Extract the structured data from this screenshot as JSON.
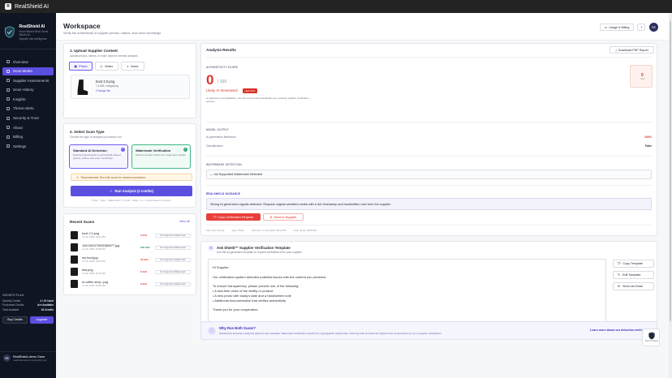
{
  "window": {
    "title": "RealShield AI"
  },
  "brand": {
    "name": "RealShield AI",
    "tagline": "Know What's Real. Know What's AI.",
    "subtag": "Supplier risk intelligence"
  },
  "nav": [
    {
      "label": "Overview"
    },
    {
      "label": "Scan Media",
      "active": true
    },
    {
      "label": "Supplier Assessments"
    },
    {
      "label": "Scan History"
    },
    {
      "label": "Insights"
    },
    {
      "label": "Threat Alerts"
    },
    {
      "label": "Security & Trust"
    },
    {
      "label": "About"
    },
    {
      "label": "Billing"
    },
    {
      "label": "Settings"
    }
  ],
  "growth": {
    "title": "GROWTH PLAN",
    "rows": [
      [
        "Monthly Credits",
        "4 / 10 Used"
      ],
      [
        "Purchased Credits",
        "Are Available"
      ],
      [
        "Total Available",
        "16 Credits"
      ]
    ],
    "buy": "Buy Credits",
    "upgrade": "Upgrade"
  },
  "user": {
    "initials": "RE",
    "name": "RealShield-demo Store",
    "email": "realshield-demo.myshopify.com"
  },
  "header": {
    "title": "Workspace",
    "subtitle": "Verify the authenticity of supplier photos, videos, and voice recordings",
    "usage": "Usage & Billing",
    "avatar": "RE"
  },
  "upload": {
    "title": "1. Upload Supplier Content",
    "sub": "Upload photos, videos, or voice clips for forensic analysis",
    "tabs": [
      "Photo",
      "Video",
      "Voice"
    ],
    "file": {
      "name": "boot 2.0.png",
      "meta": "1.5 MB  •  image/png",
      "change": "Change file"
    }
  },
  "scantype": {
    "title": "2. Select Scan Type",
    "sub": "Choose the type of analysis you want to run",
    "opt1": {
      "t": "Standard AI Detection",
      "d": "Detects AI-generated or synthetically altered photos, videos, and voice recordings"
    },
    "opt2": {
      "t": "Watermark Verification",
      "d": "Detects AI watermarks from supported models"
    },
    "reco": "Recommended: Run both scans for maximum protection",
    "run": "Run Analysis (2 credits)",
    "foot": "Photo · Video · Watermark = 1 credit · Video = 2 + 1 credit based on content"
  },
  "recent": {
    "title": "Recent Scans",
    "viewall": "View all",
    "items": [
      {
        "name": "boot 2.0.png",
        "date": "Jul 19, 2026, 04:01 PM",
        "pct": "0 Ai%",
        "color": "#d93025",
        "tag": "No Supported Watermark"
      },
      {
        "name": "1541352073535380577.jpg",
        "date": "Jul 19, 2026, 03:58 PM",
        "pct": "100 Ai%",
        "color": "#188038",
        "tag": "No Supported Watermark"
      },
      {
        "name": "my boot.jpg",
        "date": "Jul 19, 2026, 03:22 PM",
        "pct": "16 Ai%",
        "color": "#d93025",
        "tag": "No Supported Watermark"
      },
      {
        "name": "test.png",
        "date": "Jul 19, 2026, 03:15 PM",
        "pct": "6 Ai%",
        "color": "#d93025",
        "tag": "No Supported Watermark"
      },
      {
        "name": "ai coffee shop .png",
        "date": "Jul 19, 2026, 02:50 PM",
        "pct": "0 Ai%",
        "color": "#d93025",
        "tag": "No Supported Watermark"
      }
    ]
  },
  "results": {
    "title": "Analysis Results",
    "download": "Download PDF Report",
    "auth_label": "AUTHENTICITY SCORE",
    "score": "0",
    "outof": "/ 100",
    "verdict": "Likely AI-Generated",
    "risk": "High Risk",
    "note": "AI detection is probabilistic. Use this assessment alongside your existing supplier verification process.",
    "mini_score": "0",
    "mini_unit": "/100",
    "model_label": "MODEL OUTPUT",
    "m1": [
      "AI generation likelihood",
      "100%"
    ],
    "m2": [
      "Classification",
      "Fake"
    ],
    "wm_label": "WATERMARK DETECTION",
    "wm": "— No Supported Watermark Detected",
    "g_label": "REALSHIELD GUIDANCE",
    "guidance": "Strong AI-generation signals detected. Request original unedited media with a live timestamp and handwritten note from the supplier.",
    "copy": "Copy Verification Request",
    "send": "Send to Supplier",
    "foot": [
      "File: boot 2.0.png",
      "Type: Photo",
      "Scanned: Jul 19, 2026, 04:01 PM",
      "Scan ID: #c_fbd53753"
    ]
  },
  "ask": {
    "title": "Ask Shield™ Supplier Verification Template",
    "sub": "Use this AI-generated template to request verification from your supplier.",
    "body": [
      "Hi Supplier,",
      "",
      "Our verification system detected potential issues with the content you provided.",
      "",
      "To ensure transparency, please provide one of the following:",
      "• A real-time video of the facility or product",
      "• A new photo with today's date and a handwritten note",
      "• Additional documentation that verifies authenticity",
      "",
      "Thank you for your cooperation."
    ],
    "b1": "Copy Template",
    "b2": "Edit Template",
    "b3": "Send via Email"
  },
  "why": {
    "title": "Why Run Both Scans?",
    "text": "Standard AI Detection analyzes patterns and metadata. Watermark Verification checks for cryptographic watermarks. Running both provides the highest level of assurance for your supplier verifications.",
    "link": "Learn more about our detection methods"
  },
  "badge": {
    "text": "Built for Shopify"
  }
}
